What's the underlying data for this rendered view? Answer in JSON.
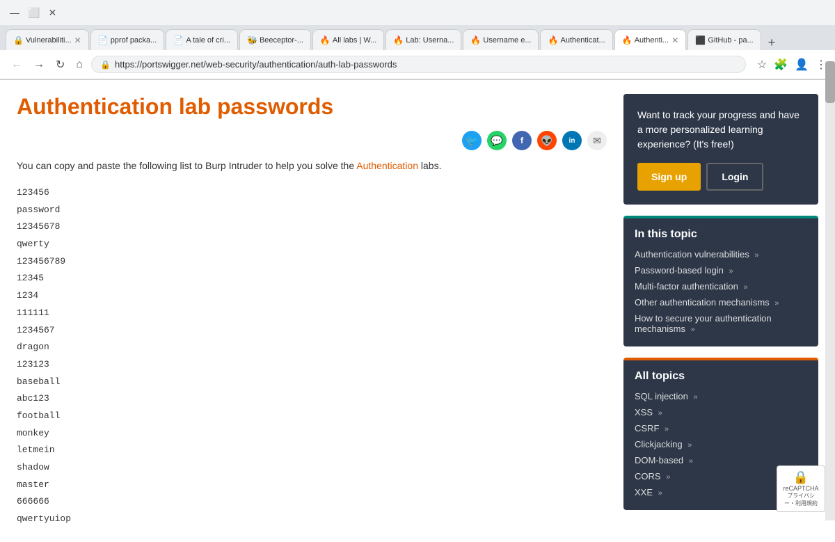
{
  "browser": {
    "url": "https://portswigger.net/web-security/authentication/auth-lab-passwords",
    "tabs": [
      {
        "label": "Vulnerabiliti...",
        "favicon": "🔒",
        "active": false
      },
      {
        "label": "pprof packa...",
        "favicon": "📄",
        "active": false
      },
      {
        "label": "A tale of cri...",
        "favicon": "📄",
        "active": false
      },
      {
        "label": "Beeceptor-...",
        "favicon": "🐝",
        "active": false
      },
      {
        "label": "All labs | W...",
        "favicon": "🔥",
        "active": false
      },
      {
        "label": "Lab: Userna...",
        "favicon": "🔥",
        "active": false
      },
      {
        "label": "Username e...",
        "favicon": "🔥",
        "active": false
      },
      {
        "label": "Authenticat...",
        "favicon": "🔥",
        "active": false
      },
      {
        "label": "Authenti...",
        "favicon": "🔥",
        "active": true
      },
      {
        "label": "GitHub - pa...",
        "favicon": "⬛",
        "active": false
      }
    ],
    "window_controls": [
      "—",
      "☐",
      "✕"
    ]
  },
  "page": {
    "title": "Authentication lab passwords",
    "intro": "You can copy and paste the following list to Burp Intruder to help you solve the",
    "intro_link": "Authentication",
    "intro_end": " labs.",
    "passwords": [
      "123456",
      "password",
      "12345678",
      "qwerty",
      "123456789",
      "12345",
      "1234",
      "111111",
      "1234567",
      "dragon",
      "123123",
      "baseball",
      "abc123",
      "football",
      "monkey",
      "letmein",
      "shadow",
      "master",
      "666666",
      "qwertyuiop"
    ]
  },
  "sidebar": {
    "progress_text": "Want to track your progress and have a more personalized learning experience? (It's free!)",
    "signup_label": "Sign up",
    "login_label": "Login",
    "in_this_topic": {
      "header": "In this topic",
      "items": [
        "Authentication vulnerabilities",
        "Password-based login",
        "Multi-factor authentication",
        "Other authentication mechanisms",
        "How to secure your authentication mechanisms"
      ]
    },
    "all_topics": {
      "header": "All topics",
      "items": [
        "SQL injection",
        "XSS",
        "CSRF",
        "Clickjacking",
        "DOM-based",
        "CORS",
        "XXE"
      ]
    }
  },
  "share": {
    "icons": [
      {
        "name": "twitter",
        "symbol": "🐦",
        "color": "#1da1f2"
      },
      {
        "name": "whatsapp",
        "symbol": "💬",
        "color": "#25d366"
      },
      {
        "name": "facebook",
        "symbol": "f",
        "color": "#4267b2"
      },
      {
        "name": "reddit",
        "symbol": "👽",
        "color": "#ff4500"
      },
      {
        "name": "linkedin",
        "symbol": "in",
        "color": "#0077b5"
      },
      {
        "name": "email",
        "symbol": "✉",
        "color": "#888"
      }
    ]
  },
  "recaptcha": {
    "label": "プライバシー・利用規約"
  }
}
